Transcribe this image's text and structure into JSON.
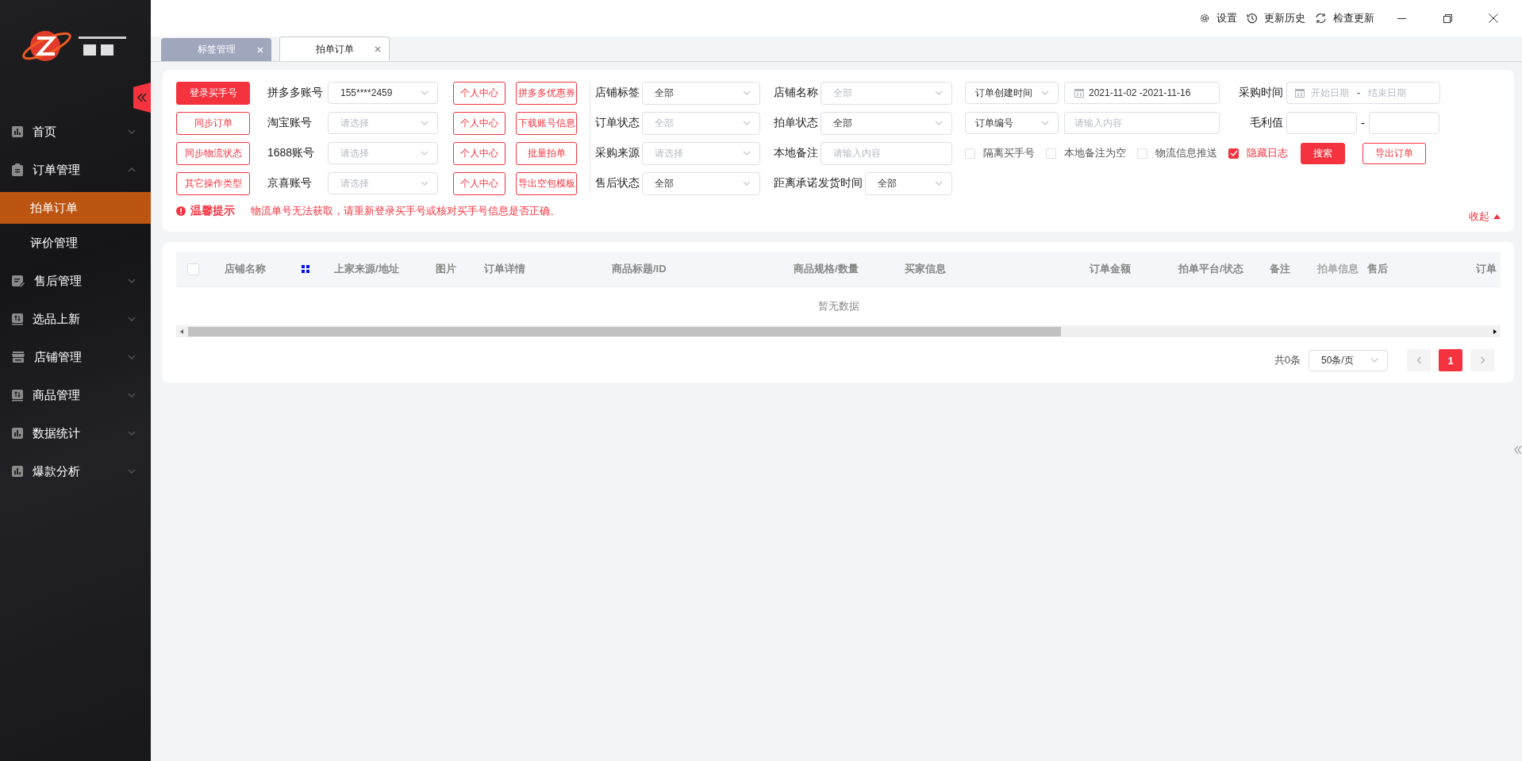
{
  "title_bar": {
    "actions": [
      {
        "kind": "settings",
        "label": "设置"
      },
      {
        "kind": "history",
        "label": "更新历史"
      },
      {
        "kind": "refresh",
        "label": "检查更新"
      }
    ]
  },
  "sidebar": {
    "items": [
      {
        "label": "首页",
        "kind": "chart",
        "expanded": false
      },
      {
        "label": "订单管理",
        "kind": "clipboard",
        "expanded": true,
        "children": [
          {
            "label": "拍单订单",
            "selected": true
          },
          {
            "label": "评价管理",
            "selected": false
          }
        ]
      },
      {
        "label": "售后管理",
        "kind": "note",
        "expanded": false
      },
      {
        "label": "选品上新",
        "kind": "swap",
        "expanded": false
      },
      {
        "label": "店铺管理",
        "kind": "store",
        "expanded": false
      },
      {
        "label": "商品管理",
        "kind": "swap",
        "expanded": false
      },
      {
        "label": "数据统计",
        "kind": "chart",
        "expanded": false
      },
      {
        "label": "爆款分析",
        "kind": "chart",
        "expanded": false
      }
    ]
  },
  "tabs": [
    {
      "label": "标签管理",
      "selected": false
    },
    {
      "label": "拍单订单",
      "selected": true
    }
  ],
  "accounts": [
    {
      "action": "登录买手号",
      "primary": true,
      "label": "拼多多账号",
      "value": "155****2459",
      "buttons": [
        "个人中心",
        "拼多多优惠券"
      ]
    },
    {
      "action": "同步订单",
      "primary": false,
      "label": "淘宝账号",
      "placeholder": "请选择",
      "buttons": [
        "个人中心",
        "下载账号信息"
      ]
    },
    {
      "action": "同步物流状态",
      "primary": false,
      "label": "1688账号",
      "placeholder": "请选择",
      "buttons": [
        "个人中心",
        "批量拍单"
      ]
    },
    {
      "action": "其它操作类型",
      "primary": false,
      "label": "京喜账号",
      "placeholder": "请选择",
      "buttons": [
        "个人中心",
        "导出空包模板"
      ]
    }
  ],
  "warning": {
    "title": "温馨提示",
    "message": "物流单号无法获取，请重新登录买手号或核对买手号信息是否正确。"
  },
  "filters": [
    [
      {
        "kind": "select",
        "label": "店铺标签",
        "value": "全部"
      },
      {
        "kind": "select",
        "label": "店铺名称",
        "placeholder": "全部"
      }
    ],
    [
      {
        "kind": "select",
        "label": "订单状态",
        "placeholder": "全部"
      },
      {
        "kind": "select",
        "label": "拍单状态",
        "value": "全部"
      }
    ],
    [
      {
        "kind": "select",
        "label": "采购来源",
        "placeholder": "请选择"
      },
      {
        "kind": "input",
        "label": "本地备注",
        "placeholder": "请输入内容"
      }
    ],
    [
      {
        "kind": "select",
        "label": "售后状态",
        "value": "全部"
      },
      {
        "kind": "select",
        "label": "距离承诺发货时间",
        "value": "全部"
      }
    ]
  ],
  "date_filter": {
    "type": "订单创建时间",
    "value": "2021-11-02  -2021-11-16"
  },
  "purchase_time": {
    "label": "采购时间",
    "start_placeholder": "开始日期",
    "separator": "-",
    "end_placeholder": "结束日期"
  },
  "order_search": {
    "type": "订单编号",
    "placeholder": "请输入内容"
  },
  "profit": {
    "label": "毛利值",
    "separator": "-"
  },
  "options": [
    {
      "label": "隔离买手号",
      "checked": false
    },
    {
      "label": "本地备注为空",
      "checked": false
    },
    {
      "label": "物流信息推送",
      "checked": false
    },
    {
      "label": "隐藏日志",
      "checked": true
    }
  ],
  "search_button": "搜索",
  "export_button": "导出订单",
  "collapse": "收起",
  "table": {
    "columns": [
      {
        "kind": "checkbox",
        "checked": false
      },
      {
        "kind": "text",
        "label": "店铺名称"
      },
      {
        "kind": "icon"
      },
      {
        "kind": "text",
        "label": "上家来源/地址"
      },
      {
        "kind": "text",
        "label": "图片"
      },
      {
        "kind": "text",
        "label": "订单详情"
      },
      {
        "kind": "text",
        "label": "商品标题/ID"
      },
      {
        "kind": "text",
        "label": "商品规格/数量"
      },
      {
        "kind": "text",
        "label": "买家信息"
      },
      {
        "kind": "text",
        "label": "订单金额"
      },
      {
        "kind": "text",
        "label": "拍单平台/状态"
      },
      {
        "kind": "text",
        "label": "备注"
      },
      {
        "kind": "text",
        "label": "拍单信息",
        "faded": true
      },
      {
        "kind": "text",
        "label": "售后"
      },
      {
        "kind": "text",
        "label": "订单"
      }
    ],
    "empty": "暂无数据"
  },
  "pagination": {
    "total": "共0条",
    "page_size": "50条/页",
    "pages": [
      {
        "label": "1",
        "selected": true
      }
    ]
  }
}
